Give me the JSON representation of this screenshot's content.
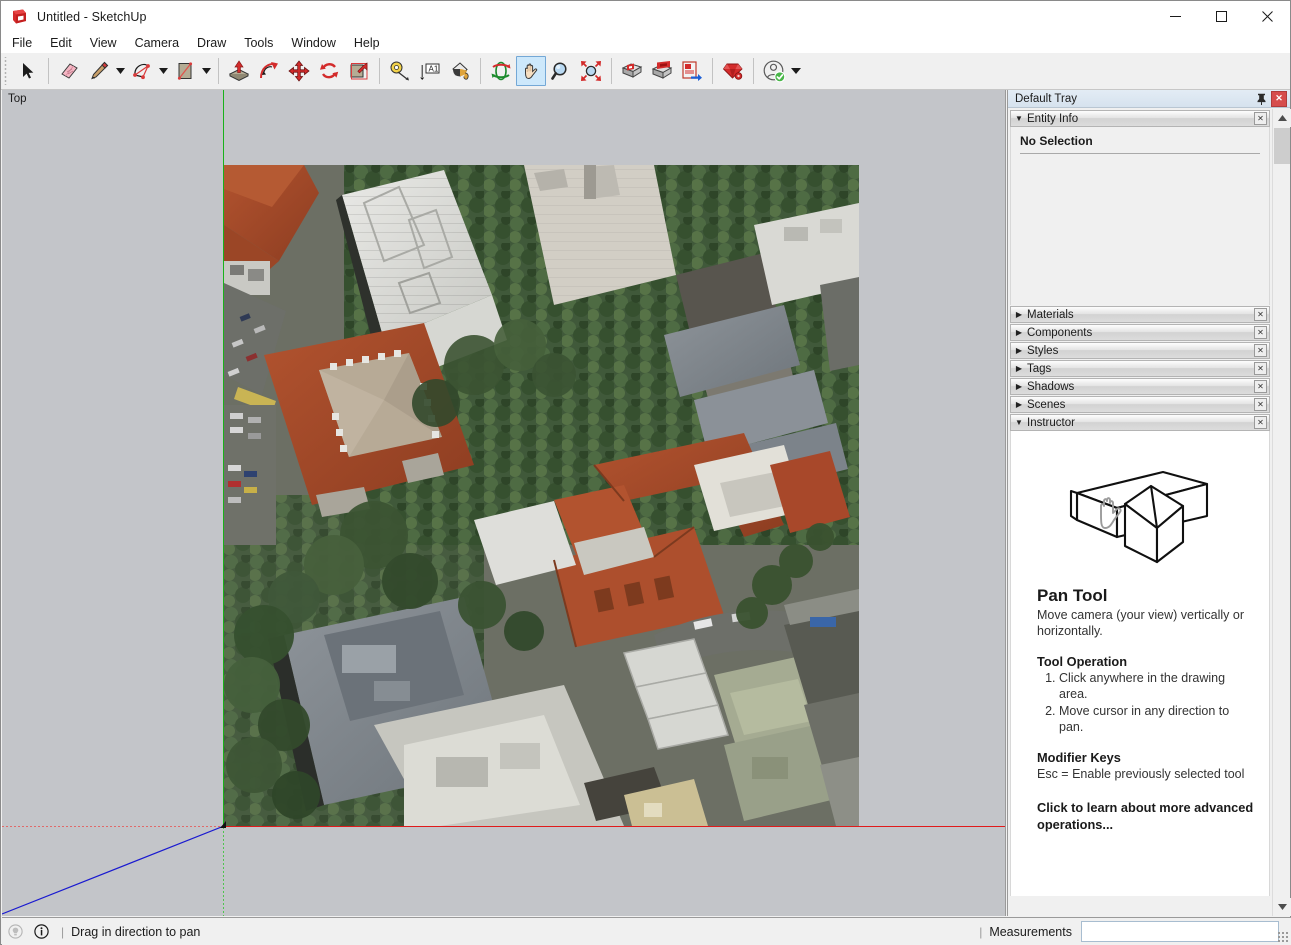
{
  "window": {
    "title": "Untitled - SketchUp",
    "logo_icon": "sketchup-logo-icon",
    "controls": [
      {
        "name": "minimize-button",
        "icon": "minimize-icon"
      },
      {
        "name": "maximize-button",
        "icon": "maximize-icon"
      },
      {
        "name": "close-button",
        "icon": "close-icon"
      }
    ]
  },
  "menubar": {
    "items": [
      {
        "label": "File"
      },
      {
        "label": "Edit"
      },
      {
        "label": "View"
      },
      {
        "label": "Camera"
      },
      {
        "label": "Draw"
      },
      {
        "label": "Tools"
      },
      {
        "label": "Window"
      },
      {
        "label": "Help"
      }
    ]
  },
  "toolbar": {
    "tools": [
      {
        "name": "select-tool",
        "icon": "arrow-cursor-icon",
        "label": "Select",
        "active": false,
        "dropdown": false
      },
      {
        "name": "eraser-tool",
        "icon": "eraser-icon",
        "label": "Eraser",
        "active": false,
        "dropdown": false
      },
      {
        "name": "line-tool",
        "icon": "pencil-icon",
        "label": "Line",
        "active": false,
        "dropdown": true
      },
      {
        "name": "arc-tool",
        "icon": "arc-icon",
        "label": "Arc",
        "active": false,
        "dropdown": true
      },
      {
        "name": "rectangle-tool",
        "icon": "rectangle-icon",
        "label": "Rectangle",
        "active": false,
        "dropdown": true
      },
      {
        "name": "pushpull-tool",
        "icon": "push-pull-icon",
        "label": "Push/Pull",
        "active": false,
        "dropdown": false
      },
      {
        "name": "followme-tool",
        "icon": "follow-me-icon",
        "label": "Follow Me",
        "active": false,
        "dropdown": false
      },
      {
        "name": "move-tool",
        "icon": "move-arrows-icon",
        "label": "Move",
        "active": false,
        "dropdown": false
      },
      {
        "name": "rotate-tool",
        "icon": "rotate-icon",
        "label": "Rotate",
        "active": false,
        "dropdown": false
      },
      {
        "name": "scale-tool",
        "icon": "scale-icon",
        "label": "Scale",
        "active": false,
        "dropdown": false
      },
      {
        "name": "tape-measure-tool",
        "icon": "tape-measure-icon",
        "label": "Tape Measure",
        "active": false,
        "dropdown": false
      },
      {
        "name": "text-tool",
        "icon": "text-label-icon",
        "label": "Text",
        "active": false,
        "dropdown": false
      },
      {
        "name": "paint-bucket-tool",
        "icon": "paint-bucket-icon",
        "label": "Paint Bucket",
        "active": false,
        "dropdown": false
      },
      {
        "name": "orbit-tool",
        "icon": "orbit-icon",
        "label": "Orbit",
        "active": false,
        "dropdown": false
      },
      {
        "name": "pan-tool",
        "icon": "hand-pan-icon",
        "label": "Pan",
        "active": true,
        "dropdown": false
      },
      {
        "name": "zoom-tool",
        "icon": "magnifier-icon",
        "label": "Zoom",
        "active": false,
        "dropdown": false
      },
      {
        "name": "zoom-extents-tool",
        "icon": "zoom-extents-icon",
        "label": "Zoom Extents",
        "active": false,
        "dropdown": false
      },
      {
        "name": "previous-view",
        "icon": "previous-view-icon",
        "label": "Previous",
        "active": false,
        "dropdown": false
      },
      {
        "name": "next-view",
        "icon": "next-view-icon",
        "label": "Next",
        "active": false,
        "dropdown": false
      },
      {
        "name": "send-to-layout",
        "icon": "send-to-layout-icon",
        "label": "LayOut",
        "active": false,
        "dropdown": false
      },
      {
        "name": "extension-warehouse",
        "icon": "ruby-gem-icon",
        "label": "Extensions",
        "active": false,
        "dropdown": false
      },
      {
        "name": "user-account",
        "icon": "user-signedin-icon",
        "label": "Account",
        "active": false,
        "dropdown": true
      }
    ]
  },
  "viewport": {
    "view_label": "Top",
    "axes": {
      "red_axis_color": "#e01b1b",
      "green_axis_color": "#19b219",
      "blue_axis_color": "#1a1ad0"
    },
    "background_color": "#c3c5c9",
    "image_alt": "Aerial satellite photograph of a city block with red-tile roofed buildings, tree-lined streets, car parks and rooftops"
  },
  "tray": {
    "title": "Default Tray",
    "pin_icon": "pin-icon",
    "close_icon": "close-icon",
    "panels": [
      {
        "label": "Entity Info",
        "expanded": true,
        "close_icon": "close-icon"
      },
      {
        "label": "Materials",
        "expanded": false,
        "close_icon": "close-icon"
      },
      {
        "label": "Components",
        "expanded": false,
        "close_icon": "close-icon"
      },
      {
        "label": "Styles",
        "expanded": false,
        "close_icon": "close-icon"
      },
      {
        "label": "Tags",
        "expanded": false,
        "close_icon": "close-icon"
      },
      {
        "label": "Shadows",
        "expanded": false,
        "close_icon": "close-icon"
      },
      {
        "label": "Scenes",
        "expanded": false,
        "close_icon": "close-icon"
      },
      {
        "label": "Instructor",
        "expanded": true,
        "close_icon": "close-icon"
      }
    ],
    "entity_info": {
      "status": "No Selection"
    },
    "instructor": {
      "illustration_icon": "house-with-hand-cursor-icon",
      "heading": "Pan Tool",
      "description": "Move camera (your view) vertically or horizontally.",
      "operation_heading": "Tool Operation",
      "operation_steps": [
        "Click anywhere in the drawing area.",
        "Move cursor in any direction to pan."
      ],
      "modifier_heading": "Modifier Keys",
      "modifier_text": "Esc = Enable previously selected tool",
      "advanced_link": "Click to learn about more advanced operations..."
    },
    "scrollbar": {
      "up_icon": "chevron-up-icon",
      "down_icon": "chevron-down-icon"
    }
  },
  "statusbar": {
    "hint_icon": "lightbulb-icon",
    "info_icon": "info-icon",
    "divider": "|",
    "status_text": "Drag in direction to pan",
    "measurements_label": "Measurements",
    "measurements_value": "",
    "measurements_placeholder": ""
  }
}
